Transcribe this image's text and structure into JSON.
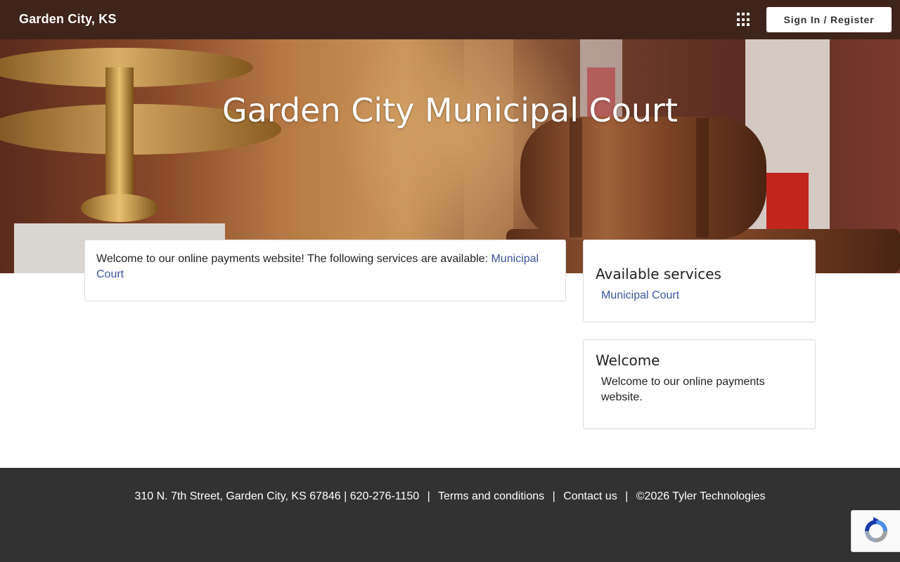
{
  "header": {
    "brand": "Garden City, KS",
    "apps_icon": "grid-apps-icon",
    "signin_label": "Sign In / Register"
  },
  "hero": {
    "title": "Garden City Municipal Court"
  },
  "main": {
    "intro_text": "Welcome to our online payments website! The following services are available: ",
    "intro_link": "Municipal Court"
  },
  "sidebar": {
    "services_title": "Available services",
    "services": [
      {
        "label": "Municipal Court"
      }
    ],
    "welcome_title": "Welcome",
    "welcome_text": "Welcome to our online payments website."
  },
  "footer": {
    "address": "310 N. 7th Street, Garden City, KS 67846 | 620-276-1150",
    "terms": "Terms and conditions",
    "contact": "Contact us",
    "copyright": "©2026 Tyler Technologies",
    "separator": "|"
  },
  "colors": {
    "topbar": "#3f241b",
    "link": "#3b54a3",
    "footer": "#323232"
  },
  "recaptcha": {
    "icon": "recaptcha-icon"
  }
}
